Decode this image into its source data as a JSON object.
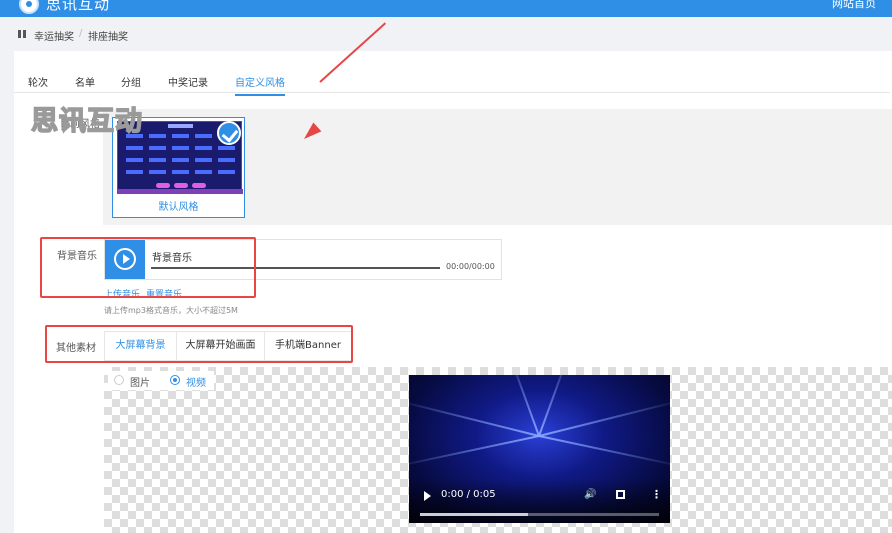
{
  "header": {
    "brand": "思讯互动",
    "site_home": "网站首页"
  },
  "breadcrumb": {
    "items": [
      "幸运抽奖",
      "排座抽奖"
    ],
    "separator": "/"
  },
  "tabs": [
    {
      "label": "轮次",
      "active": false
    },
    {
      "label": "名单",
      "active": false
    },
    {
      "label": "分组",
      "active": false
    },
    {
      "label": "中奖记录",
      "active": false
    },
    {
      "label": "自定义风格",
      "active": true
    }
  ],
  "watermark": "思讯互动",
  "style_section": {
    "label": "目前风格",
    "selected": {
      "name": "默认风格",
      "checked": true
    }
  },
  "music_section": {
    "label": "背景音乐",
    "track_name": "背景音乐",
    "time": "00:00/00:00",
    "upload_link": "上传音乐",
    "reset_link": "重置音乐",
    "hint": "请上传mp3格式音乐，大小不超过5M"
  },
  "materials_section": {
    "label": "其他素材",
    "tabs": [
      {
        "label": "大屏幕背景",
        "active": true
      },
      {
        "label": "大屏幕开始画面",
        "active": false
      },
      {
        "label": "手机端Banner",
        "active": false
      }
    ],
    "media_type": {
      "options": [
        {
          "label": "图片",
          "checked": false
        },
        {
          "label": "视频",
          "checked": true
        }
      ]
    },
    "video": {
      "time": "0:00 / 0:05",
      "progress": 0.45
    }
  },
  "colors": {
    "primary": "#2f8fe6",
    "annotation": "#e84545",
    "video_bg": "#101a86"
  }
}
